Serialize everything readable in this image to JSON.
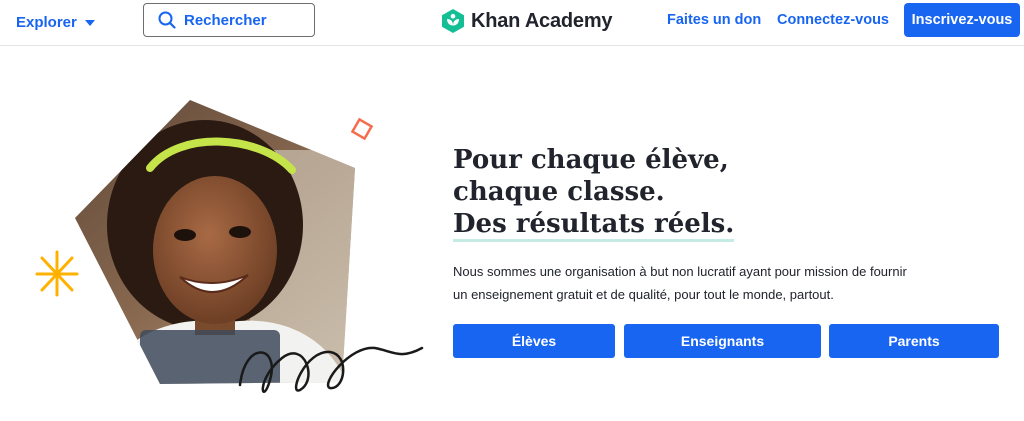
{
  "header": {
    "explore_label": "Explorer",
    "search_placeholder": "Rechercher",
    "logo_text": "Khan Academy",
    "donate_label": "Faites un don",
    "login_label": "Connectez-vous",
    "signup_label": "Inscrivez-vous"
  },
  "hero": {
    "headline_line1": "Pour chaque élève,",
    "headline_line2": "chaque classe.",
    "headline_line3": "Des résultats réels.",
    "subtitle": "Nous sommes une organisation à but non lucratif ayant pour mission de fournir un enseignement gratuit et de qualité, pour tout le monde, partout.",
    "buttons": {
      "students": "Élèves",
      "teachers": "Enseignants",
      "parents": "Parents"
    }
  },
  "colors": {
    "brand_blue": "#1865f2",
    "logo_green": "#14bf96",
    "text_dark": "#21242c",
    "underline_mint": "#c4ece4",
    "accent_orange": "#f56c4b",
    "accent_yellow": "#ffb100"
  },
  "icons": {
    "explore_caret": "caret-down-icon",
    "search": "search-icon",
    "logo": "khan-academy-logo-icon"
  }
}
